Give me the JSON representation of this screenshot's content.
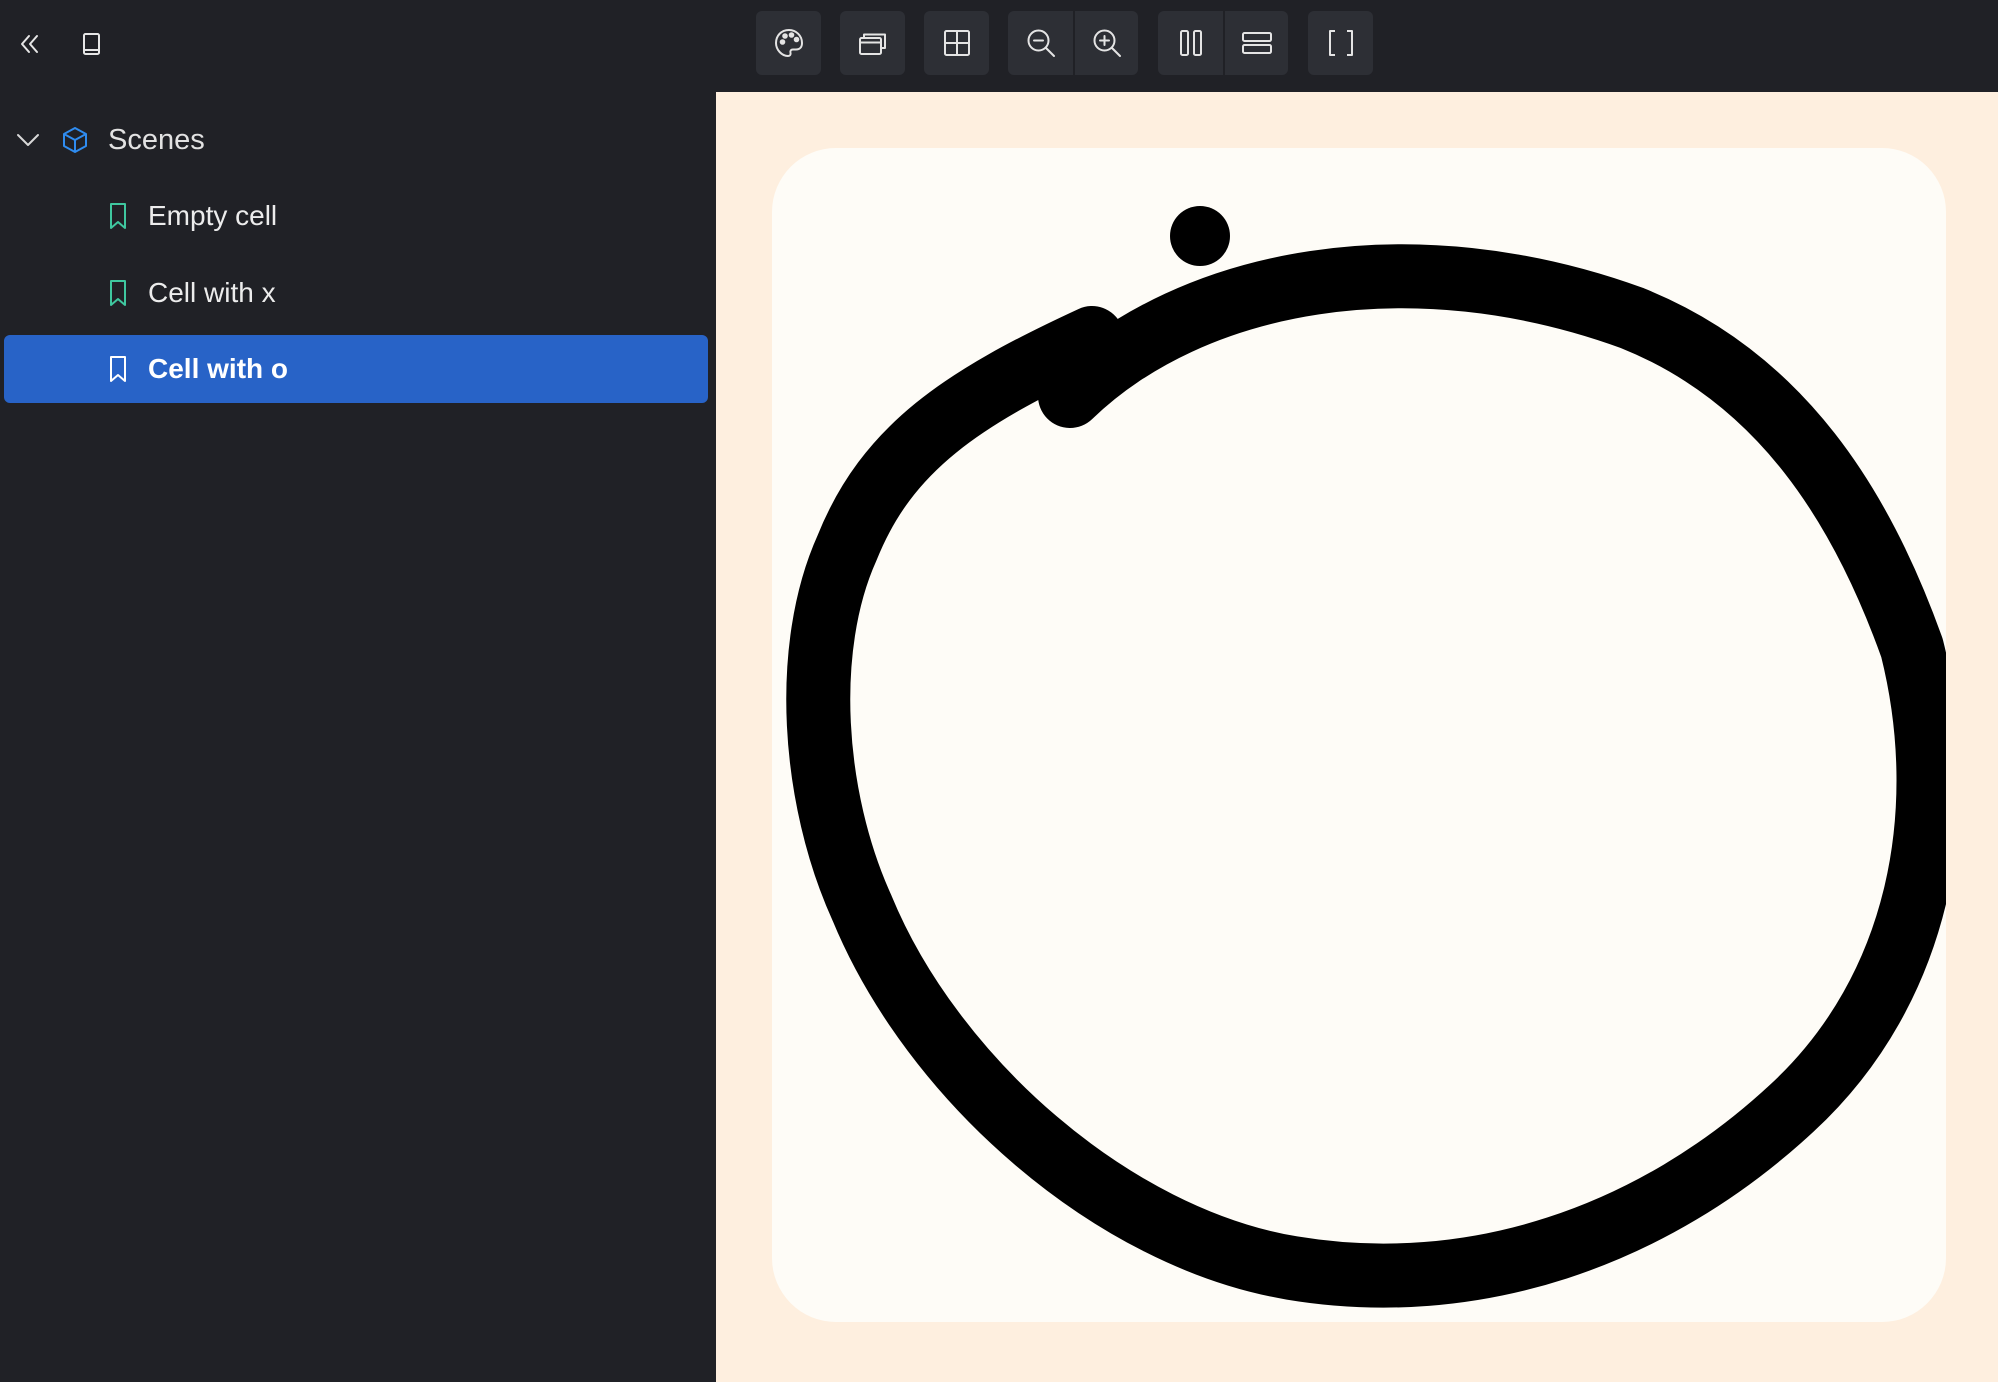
{
  "topbar": {
    "left_buttons": [
      {
        "name": "collapse-sidebar-icon"
      },
      {
        "name": "book-icon"
      }
    ],
    "toolbar_groups": [
      [
        {
          "name": "palette-icon"
        }
      ],
      [
        {
          "name": "layers-icon"
        }
      ],
      [
        {
          "name": "grid-icon"
        }
      ],
      [
        {
          "name": "zoom-out-icon"
        },
        {
          "name": "zoom-in-icon"
        }
      ],
      [
        {
          "name": "layout-columns-icon"
        },
        {
          "name": "layout-rows-icon"
        }
      ],
      [
        {
          "name": "fullscreen-brackets-icon"
        }
      ]
    ]
  },
  "sidebar": {
    "root": {
      "label": "Scenes",
      "expanded": true
    },
    "stories": [
      {
        "label": "Empty cell",
        "selected": false
      },
      {
        "label": "Cell with x",
        "selected": false
      },
      {
        "label": "Cell with o",
        "selected": true
      }
    ]
  },
  "colors": {
    "background": "#202126",
    "selected": "#2863c7",
    "accent_cube": "#2f8cf0",
    "bookmark_green": "#3fc79f",
    "canvas_bg": "#feefdf",
    "cell_bg": "#fefcf7",
    "mark": "#000000"
  },
  "canvas": {
    "cell_mark": "o"
  }
}
